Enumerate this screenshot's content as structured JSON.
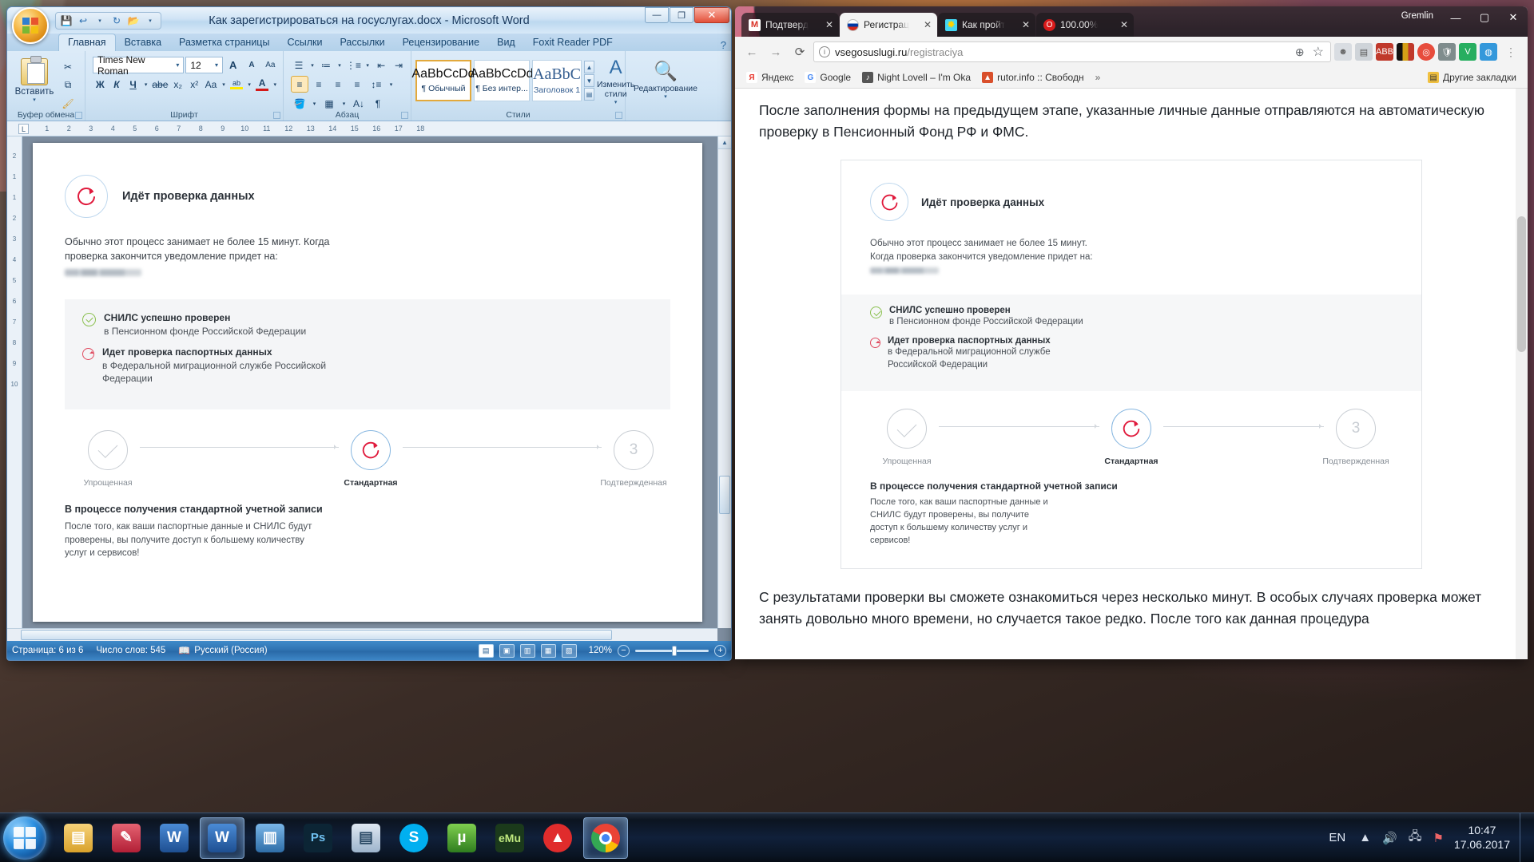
{
  "word": {
    "title": "Как зарегистрироваться на госуслугах.docx - Microsoft Word",
    "quick_access": [
      "save-icon",
      "undo-icon",
      "redo-icon",
      "open-icon",
      "more-icon"
    ],
    "window_buttons": {
      "minimize": "—",
      "maximize": "❐",
      "close": "✕"
    },
    "help_icon": "?",
    "tabs": [
      {
        "label": "Главная",
        "active": true
      },
      {
        "label": "Вставка",
        "active": false
      },
      {
        "label": "Разметка страницы",
        "active": false
      },
      {
        "label": "Ссылки",
        "active": false
      },
      {
        "label": "Рассылки",
        "active": false
      },
      {
        "label": "Рецензирование",
        "active": false
      },
      {
        "label": "Вид",
        "active": false
      },
      {
        "label": "Foxit Reader PDF",
        "active": false
      }
    ],
    "groups": {
      "clipboard": {
        "label": "Буфер обмена",
        "paste_label": "Вставить"
      },
      "font": {
        "label": "Шрифт",
        "font_name": "Times New Roman",
        "font_size": "12",
        "bold": "Ж",
        "italic": "К",
        "underline": "Ч",
        "strike": "abe",
        "sub": "x₂",
        "sup": "x²",
        "case": "Aa",
        "grow": "A",
        "shrink": "A",
        "clear": "Aa",
        "highlight": "ab",
        "color": "A"
      },
      "paragraph": {
        "label": "Абзац",
        "pilcrow": "¶"
      },
      "styles": {
        "label": "Стили",
        "gallery": [
          {
            "preview": "AaBbCcDd",
            "name": "¶ Обычный",
            "selected": true
          },
          {
            "preview": "AaBbCcDd",
            "name": "¶ Без интер...",
            "selected": false
          },
          {
            "preview": "AaBbC",
            "name": "Заголовок 1",
            "selected": false
          }
        ],
        "change_styles": "Изменить стили"
      },
      "editing": {
        "label": "Редактирование"
      }
    },
    "ruler": {
      "corner": "L",
      "marks": [
        "1",
        "2",
        "3",
        "4",
        "5",
        "6",
        "7",
        "8",
        "9",
        "10",
        "11",
        "12",
        "13",
        "14",
        "15",
        "16",
        "17",
        "18"
      ],
      "vmarks": [
        "2",
        "1",
        "",
        "1",
        "2",
        "3",
        "4",
        "5",
        "6",
        "7",
        "8",
        "9",
        "10"
      ]
    },
    "status": {
      "page": "Страница: 6 из 6",
      "words": "Число слов: 545",
      "language": "Русский (Россия)",
      "zoom": "120%",
      "zoom_out": "−",
      "zoom_in": "+"
    }
  },
  "gosuslugi": {
    "heading": "Идёт проверка данных",
    "lead_line1": "Обычно этот процесс занимает не более 15 минут. Когда",
    "lead_line2": "проверка закончится уведомление придет на:",
    "email_blurred": "",
    "checks": [
      {
        "status": "ok",
        "title": "СНИЛС успешно проверен",
        "subtitle": "в Пенсионном фонде Российской Федерации"
      },
      {
        "status": "pending",
        "title": "Идет проверка паспортных данных",
        "subtitle": "в Федеральной миграционной службе Российской Федерации"
      }
    ],
    "steps": [
      {
        "label": "Упрощенная",
        "state": "done",
        "glyph": "check"
      },
      {
        "label": "Стандартная",
        "state": "current",
        "glyph": "spinner"
      },
      {
        "label": "Подтвержденная",
        "state": "todo",
        "glyph": "3"
      }
    ],
    "progress_title": "В процессе получения стандартной учетной записи",
    "progress_text": "После того, как ваши паспортные данные и СНИЛС будут проверены, вы получите доступ к большему количеству услуг и сервисов!"
  },
  "chrome": {
    "profile_name": "Gremlin",
    "window_buttons": {
      "minimize": "—",
      "maximize": "▢",
      "close": "✕"
    },
    "tabs": [
      {
        "favicon": "gmail-icon",
        "title": "Подтверд",
        "active": false,
        "close": "✕"
      },
      {
        "favicon": "russia-flag-icon",
        "title": "Регистрац",
        "active": true,
        "close": "✕"
      },
      {
        "favicon": "sun-icon",
        "title": "Как пройт",
        "active": false,
        "close": "✕"
      },
      {
        "favicon": "opera-icon",
        "title": "100.00%",
        "active": false,
        "close": "✕"
      }
    ],
    "nav": {
      "back": "←",
      "forward": "→",
      "reload": "⟳"
    },
    "omnibox": {
      "security_icon": "info-icon",
      "url_host": "vsegosuslugi.ru",
      "url_path": "/registraciya",
      "zoom_icon": "zoom-in-icon",
      "bookmark_icon": "star-icon"
    },
    "extensions": [
      "profile-icon",
      "adblock-icon",
      "abbyy-icon",
      "flag-icon",
      "target-icon",
      "shield-icon",
      "v-icon",
      "globe-icon"
    ],
    "bookmarks": [
      {
        "icon": "yandex-icon",
        "label": "Яндекс"
      },
      {
        "icon": "google-icon",
        "label": "Google"
      },
      {
        "icon": "music-icon",
        "label": "Night Lovell – I'm Oka"
      },
      {
        "icon": "rutor-icon",
        "label": "rutor.info :: Свободн"
      }
    ],
    "bookmarks_overflow": "»",
    "other_bookmarks": {
      "icon": "folder-icon",
      "label": "Другие закладки"
    }
  },
  "page": {
    "intro": "После заполнения формы на предыдущем этапе, указанные личные данные отправляются на автоматическую проверку в Пенсионный Фонд РФ и ФМС.",
    "outro": "С результатами проверки вы сможете ознакомиться через несколько минут. В особых случаях проверка может занять довольно много времени, но случается такое редко. После того как данная процедура"
  },
  "taskbar": {
    "start": "start-orb",
    "items": [
      {
        "name": "explorer",
        "glyph": "▤",
        "color": "#e8b547",
        "active": false
      },
      {
        "name": "paint",
        "glyph": "✎",
        "color": "#c9334a",
        "active": false
      },
      {
        "name": "word-pinned",
        "glyph": "W",
        "color": "#2b5797",
        "active": false
      },
      {
        "name": "word-doc",
        "glyph": "W",
        "color": "#2b5797",
        "active": true
      },
      {
        "name": "image-viewer",
        "glyph": "▥",
        "color": "#3f7fbf",
        "active": false
      },
      {
        "name": "photoshop",
        "glyph": "Ps",
        "color": "#0d2d45",
        "active": false
      },
      {
        "name": "scanner",
        "glyph": "▤",
        "color": "#7aa2c4",
        "active": false
      },
      {
        "name": "skype",
        "glyph": "S",
        "color": "#00aff0",
        "active": false
      },
      {
        "name": "utorrent",
        "glyph": "µ",
        "color": "#4fa52e",
        "active": false
      },
      {
        "name": "emule",
        "glyph": "e",
        "color": "#1b3a1b",
        "active": false
      },
      {
        "name": "anydesk",
        "glyph": "▲",
        "color": "#e02c2c",
        "active": false
      },
      {
        "name": "chrome",
        "glyph": "◉",
        "color": "#ffffff",
        "active": true
      }
    ],
    "tray": {
      "language": "EN",
      "arrow": "▲",
      "icons": [
        "volume-icon",
        "network-icon",
        "action-center-icon"
      ],
      "time": "10:47",
      "date": "17.06.2017"
    }
  }
}
